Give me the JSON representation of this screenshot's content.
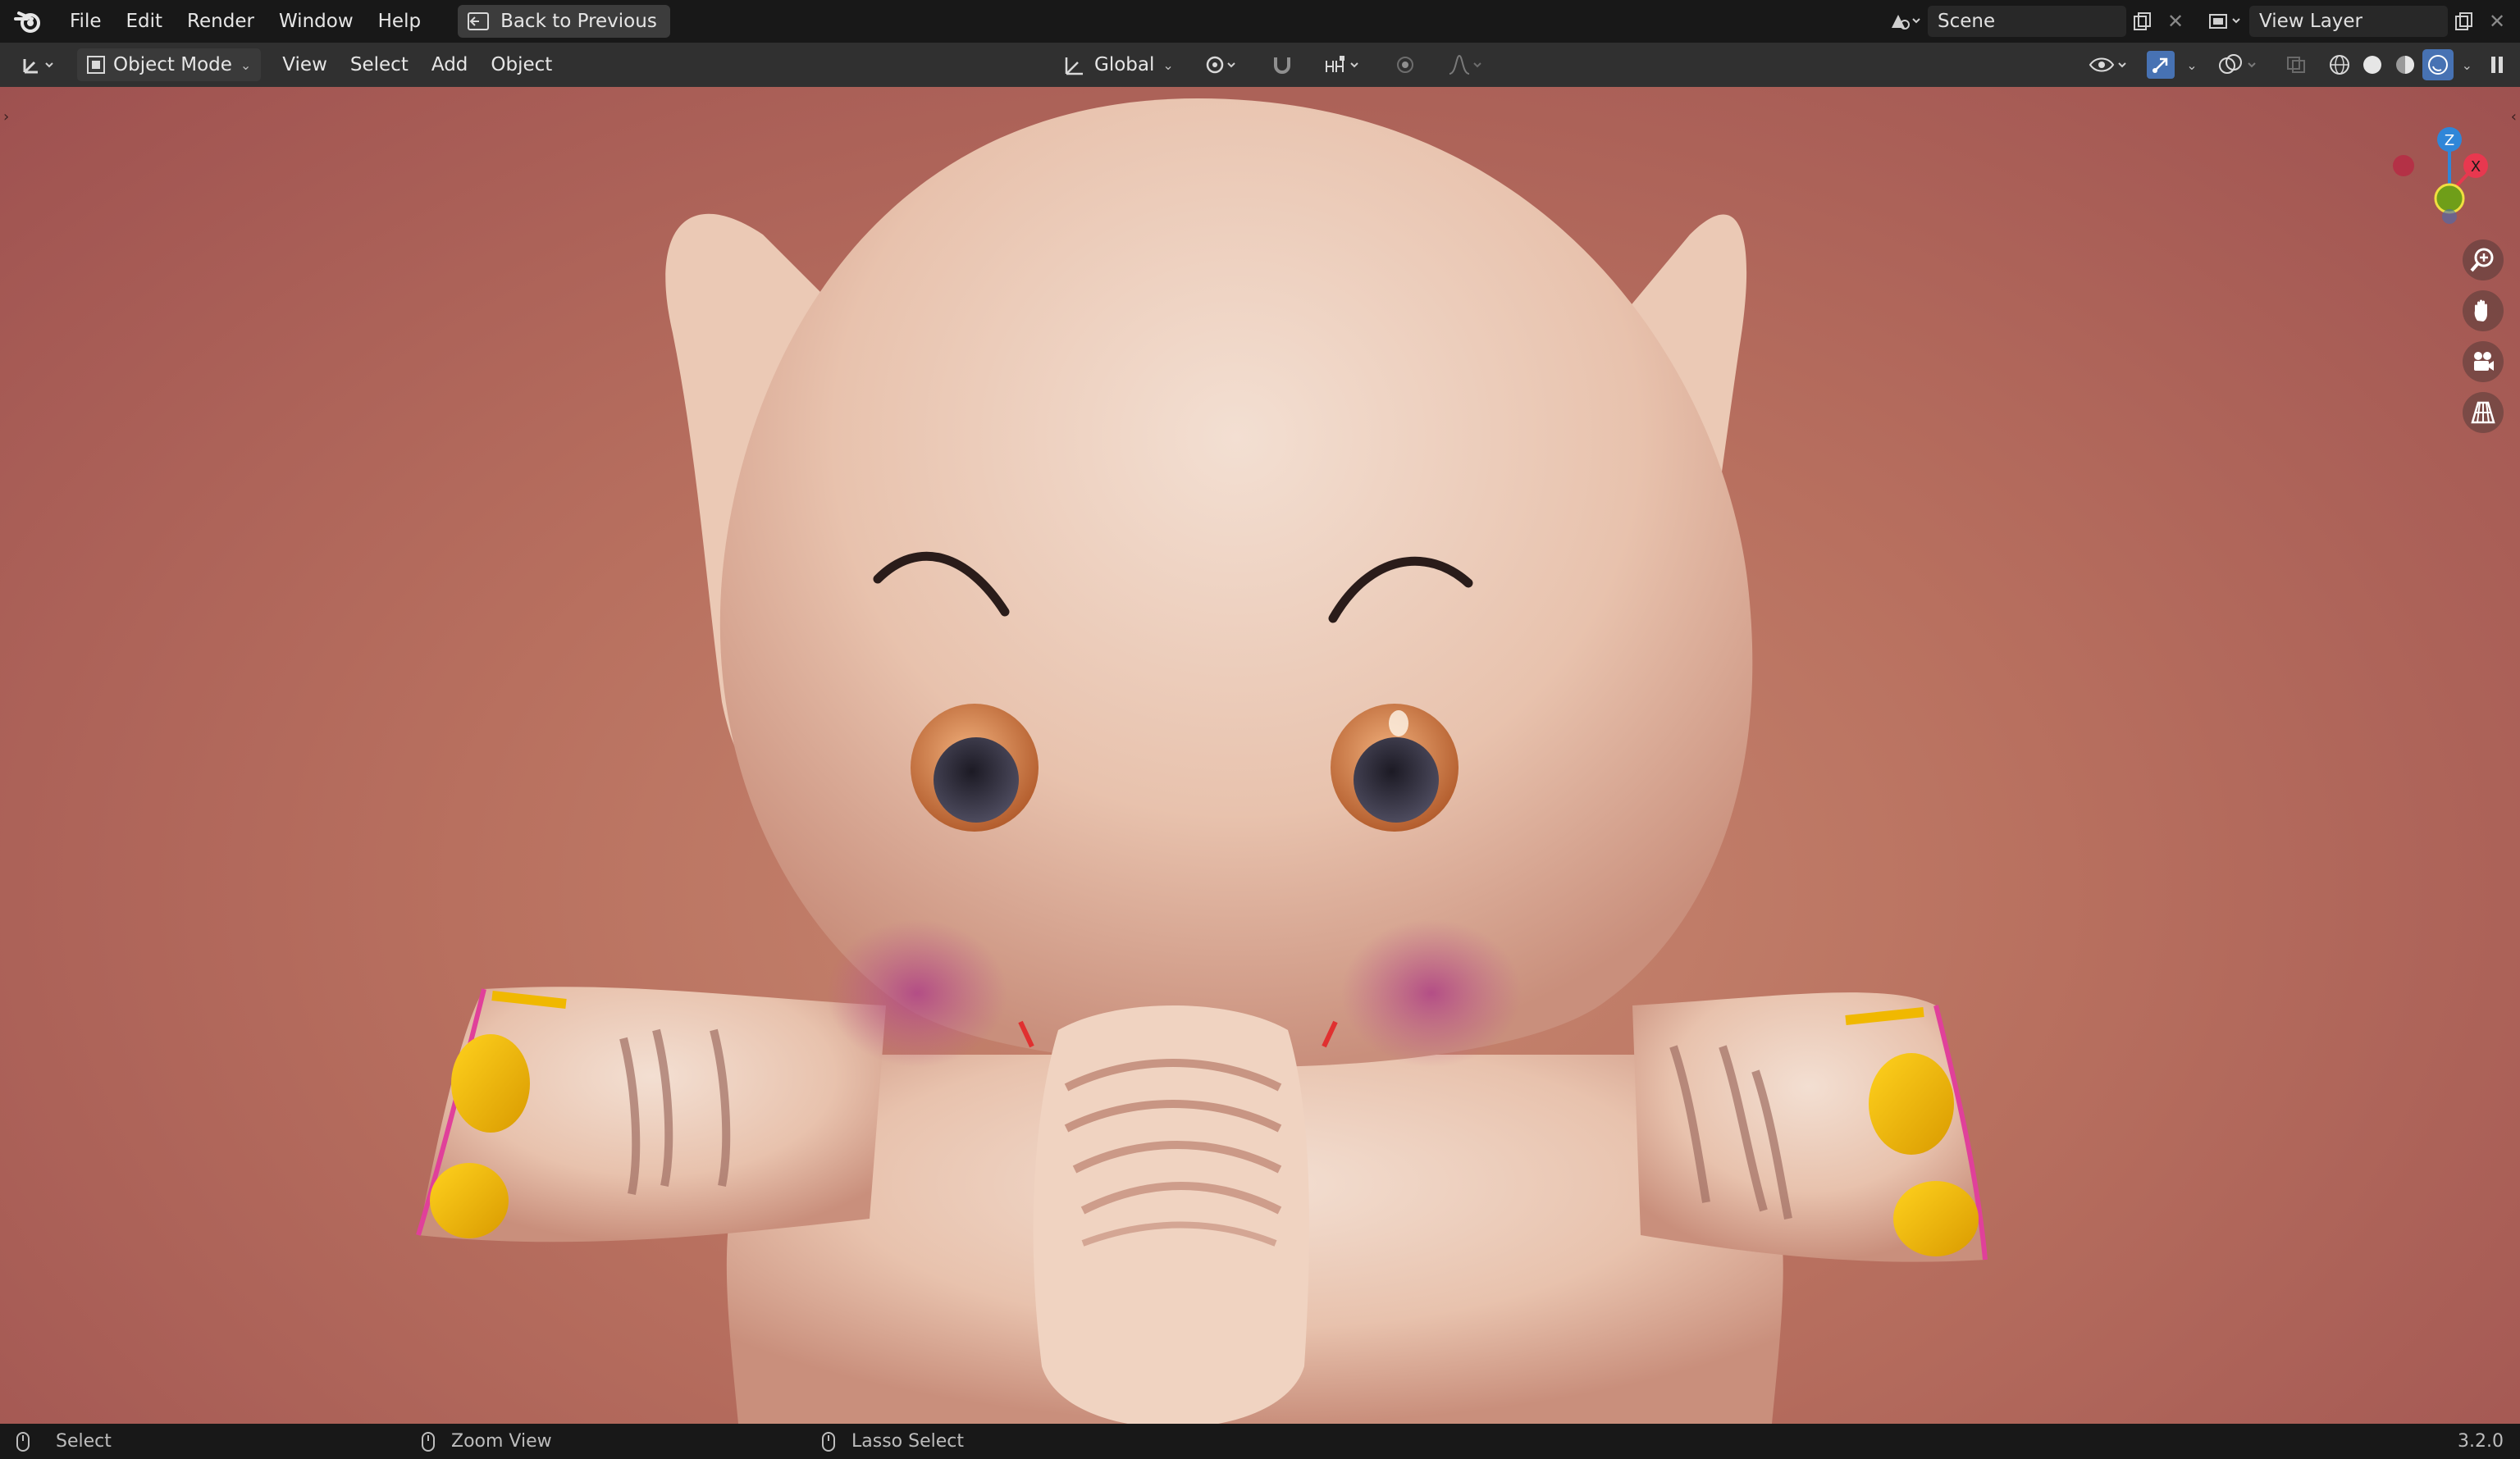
{
  "topbar": {
    "menus": [
      "File",
      "Edit",
      "Render",
      "Window",
      "Help"
    ],
    "back_button": "Back to Previous",
    "scene_field": "Scene",
    "view_layer_field": "View Layer"
  },
  "toolbar": {
    "mode": "Object Mode",
    "menus": [
      "View",
      "Select",
      "Add",
      "Object"
    ],
    "transform_orientation": "Global"
  },
  "gizmo": {
    "axis_z": "Z",
    "axis_x": "X",
    "colors": {
      "x": "#e8384f",
      "y": "#6f9e19",
      "z": "#2f86d8"
    }
  },
  "statusbar": {
    "left_mouse": "Select",
    "middle_mouse": "Zoom View",
    "right_mouse": "Lasso Select",
    "version": "3.2.0"
  },
  "colors": {
    "accent": "#4772b3",
    "background_pink": "#b8705f"
  }
}
